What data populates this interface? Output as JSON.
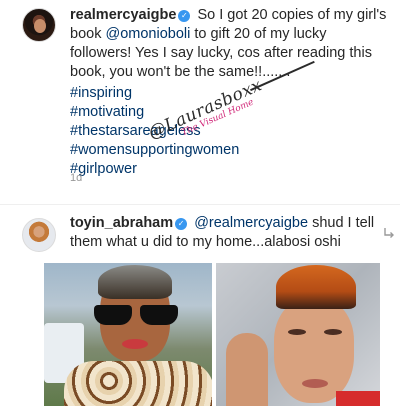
{
  "comment_1": {
    "username": "realmercyaigbe",
    "text_before_mention": "So I got 20 copies of my girl's book",
    "mention": "@omonioboli",
    "text_after_mention": "to gift 20 of my lucky followers! Yes I say lucky, cos after reading this book, you won't be the same!!.......",
    "hashtags": [
      "#inspiring",
      "#motivating",
      "#thestarsareageless",
      "#womensupportingwomen",
      "#girlpower"
    ],
    "time": "1d"
  },
  "watermark": {
    "main": "@Laurasboxx",
    "sub": "The Visual Home"
  },
  "comment_2": {
    "username": "toyin_abraham",
    "mention": "@realmercyaigbe",
    "text": "shud I tell them what u did to my home...alabosi oshi"
  },
  "icons": {
    "verified": "verified-badge-icon",
    "reply": "reply-arrow-icon"
  },
  "colors": {
    "link": "#003569",
    "verified": "#3897f0",
    "muted": "#999999"
  }
}
